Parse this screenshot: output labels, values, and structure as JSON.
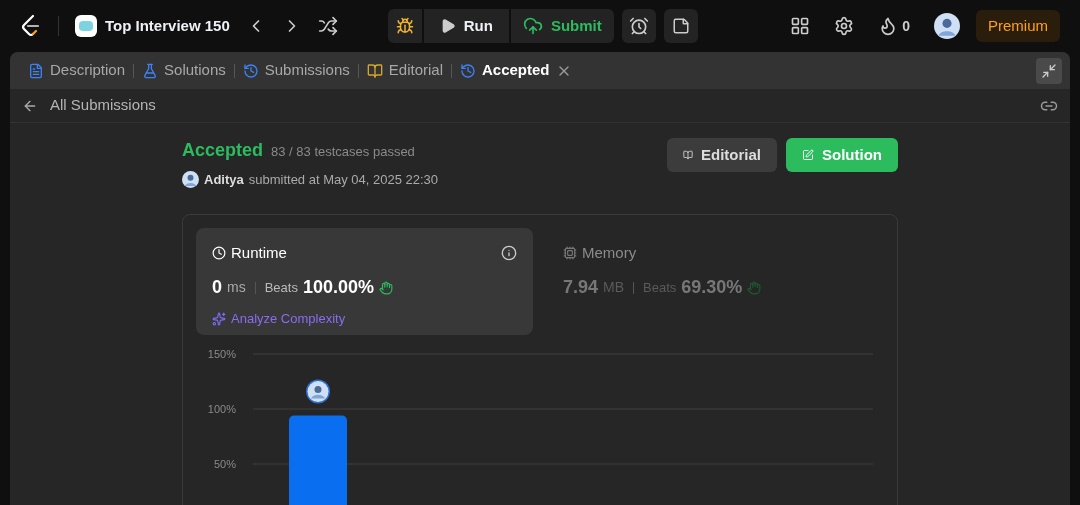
{
  "top_bar": {
    "title": "Top Interview 150",
    "run": "Run",
    "submit": "Submit",
    "streak": "0",
    "premium": "Premium"
  },
  "tabs": [
    {
      "label": "Description",
      "kind": "description",
      "selected": false,
      "closable": false
    },
    {
      "label": "Solutions",
      "kind": "solutions",
      "selected": false,
      "closable": false
    },
    {
      "label": "Submissions",
      "kind": "submissions",
      "selected": false,
      "closable": false
    },
    {
      "label": "Editorial",
      "kind": "editorial",
      "selected": false,
      "closable": false
    },
    {
      "label": "Accepted",
      "kind": "result",
      "selected": true,
      "closable": true
    }
  ],
  "back_link": "All Submissions",
  "result": {
    "status": "Accepted",
    "testcases": "83 / 83 testcases passed",
    "user": "Aditya",
    "submitted": "submitted at May 04, 2025 22:30"
  },
  "buttons": [
    {
      "label": "Editorial",
      "kind": "editorial"
    },
    {
      "label": "Solution",
      "kind": "solution"
    }
  ],
  "metrics": [
    {
      "title": "Runtime",
      "kind": "runtime",
      "value": "0",
      "unit": "ms",
      "beats_label": "Beats",
      "beats": "100.00%",
      "selected": true
    },
    {
      "title": "Memory",
      "kind": "memory",
      "value": "7.94",
      "unit": "MB",
      "beats_label": "Beats",
      "beats": "69.30%",
      "selected": false
    }
  ],
  "analyze": "Analyze Complexity",
  "chart_data": {
    "type": "bar",
    "values": [
      94
    ],
    "ylim": [
      0,
      150
    ],
    "yticks": [
      {
        "value": 50,
        "label": "50%"
      },
      {
        "value": 100,
        "label": "100%"
      },
      {
        "value": 150,
        "label": "150%"
      }
    ]
  }
}
